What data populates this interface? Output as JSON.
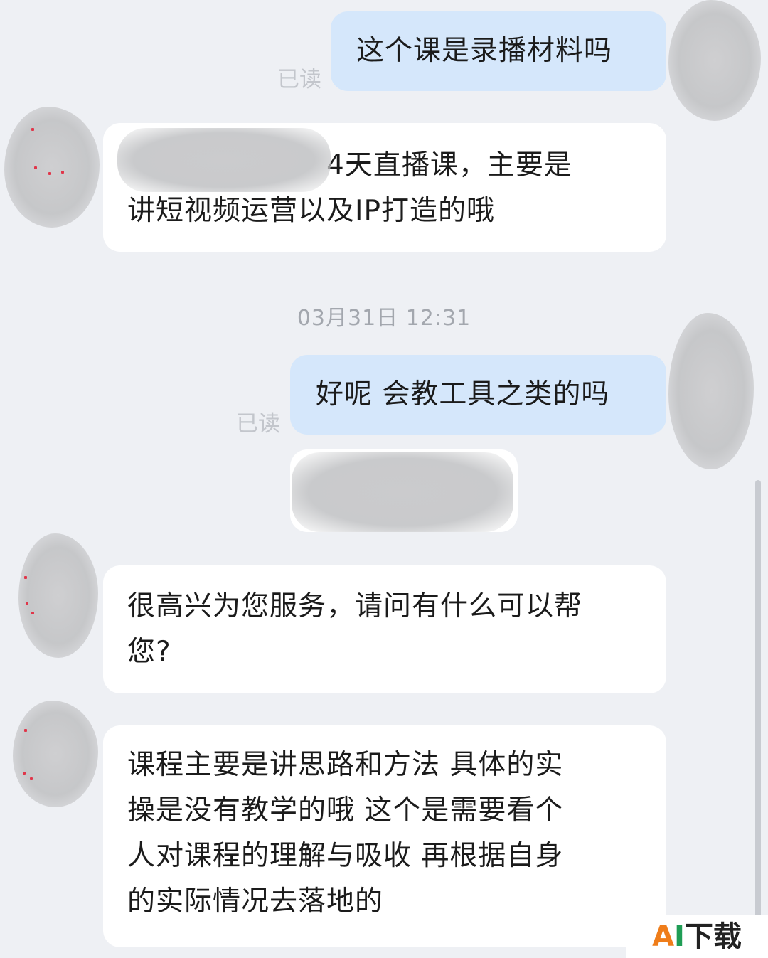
{
  "chat": {
    "messages": [
      {
        "direction": "out",
        "text": "这个课是录播材料吗",
        "status": "已读"
      },
      {
        "direction": "in",
        "lines": [
          "4天直播课，主要是",
          "讲短视频运营以及IP打造的哦"
        ]
      },
      {
        "direction": "out",
        "text": "好呢 会教工具之类的吗",
        "status": "已读"
      },
      {
        "direction": "in",
        "lines": [
          "很高兴为您服务，请问有什么可以帮",
          "您?"
        ]
      },
      {
        "direction": "in",
        "lines": [
          "课程主要是讲思路和方法 具体的实",
          "操是没有教学的哦  这个是需要看个",
          "人对课程的理解与吸收  再根据自身",
          "的实际情况去落地的"
        ]
      }
    ],
    "timestamp": "03月31日 12:31"
  },
  "watermark": {
    "a": "A",
    "i": "I",
    "rest": "下载"
  },
  "colors": {
    "background": "#eef0f4",
    "outgoing_bubble": "#d5e7fb",
    "incoming_bubble": "#ffffff",
    "read_status": "#c3c6cc",
    "timestamp": "#a3a7ae"
  }
}
